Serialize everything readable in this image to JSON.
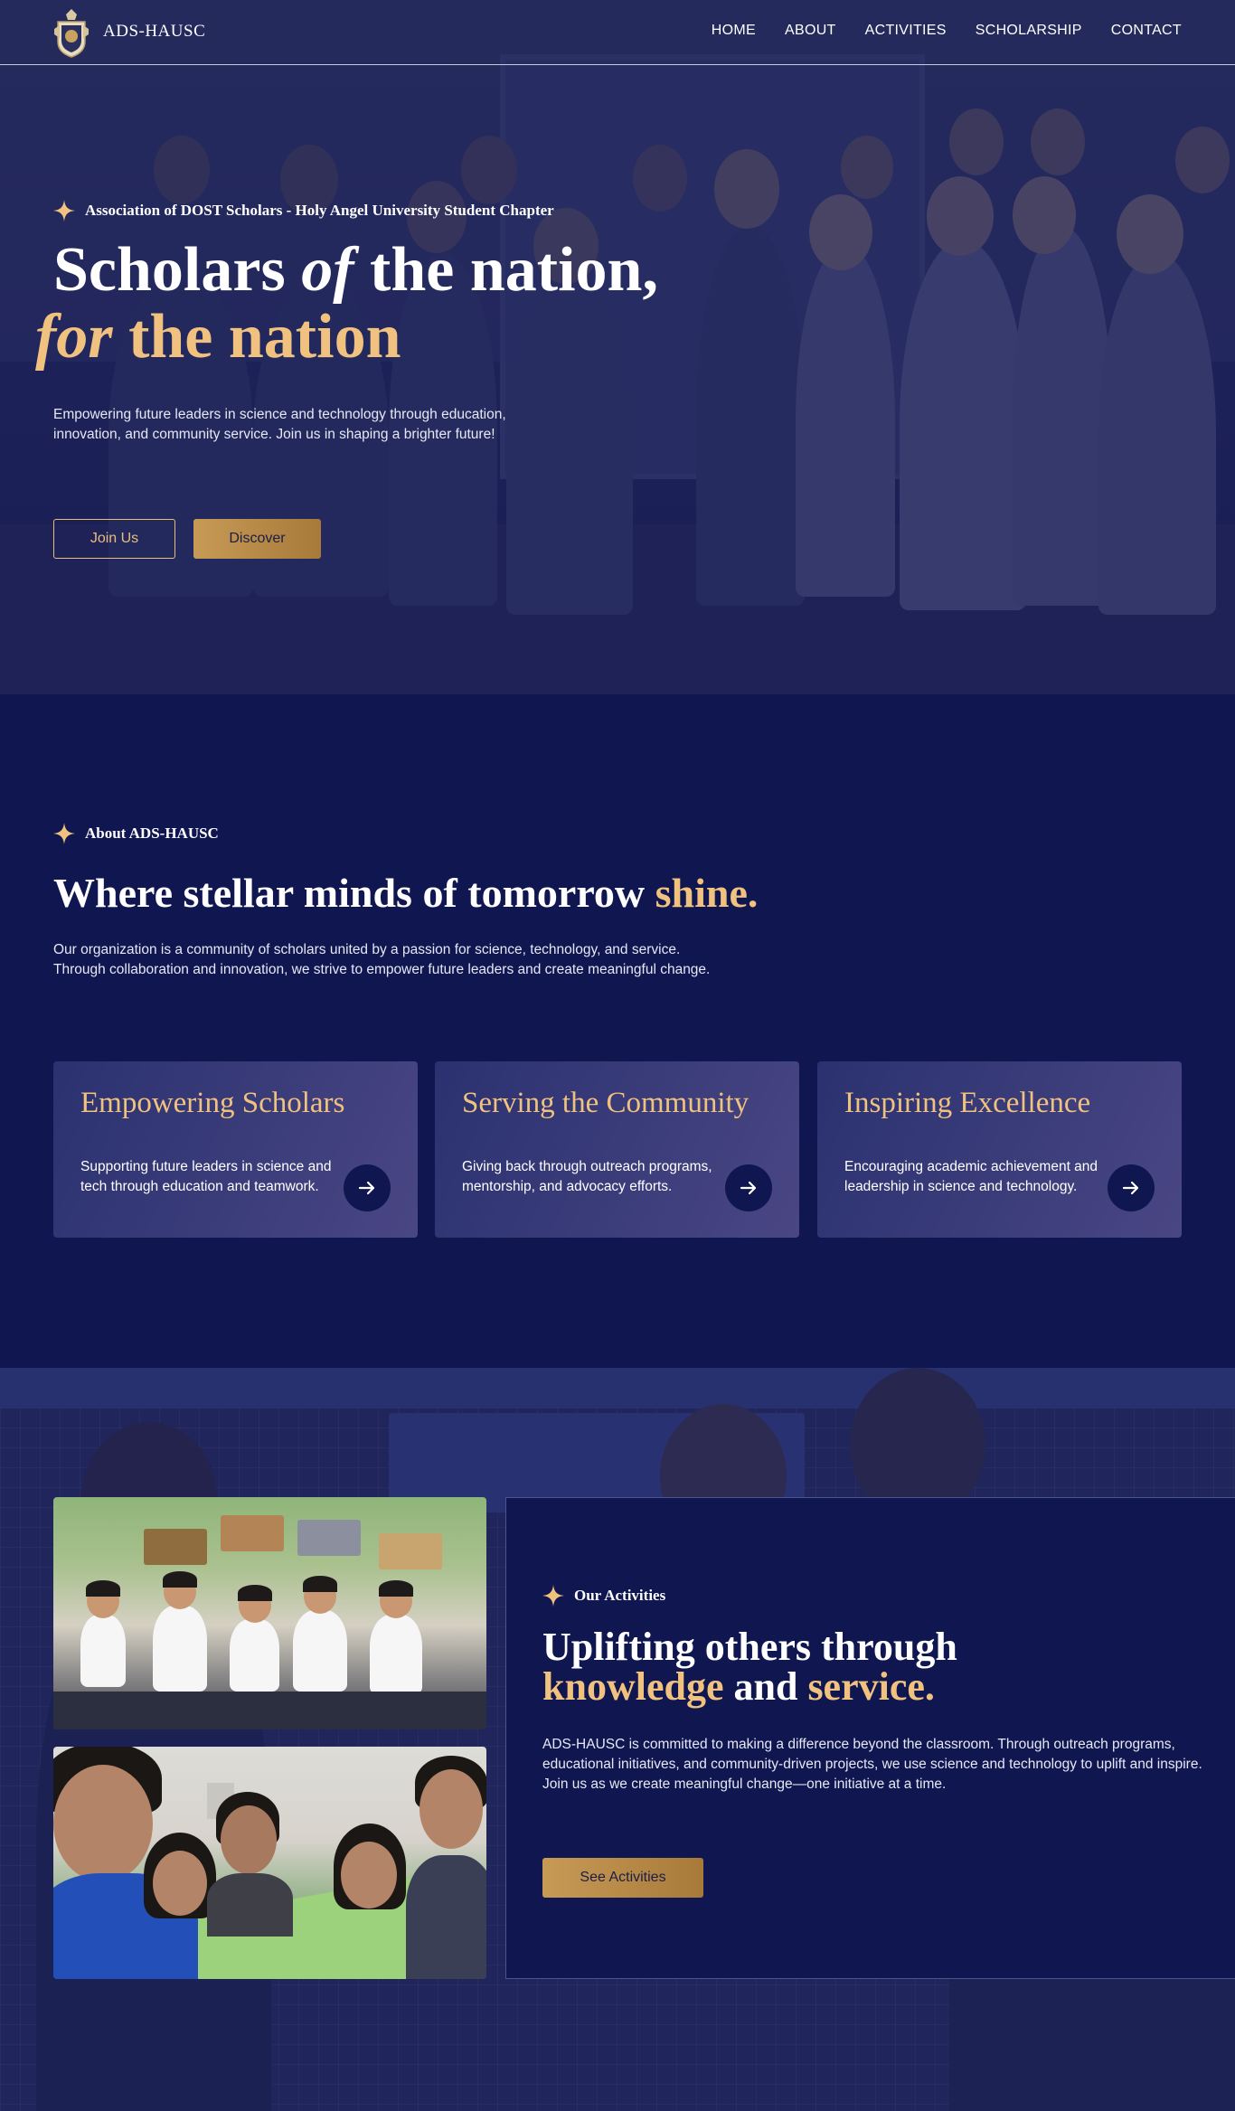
{
  "header": {
    "brand": "ADS-HAUSC",
    "nav": [
      "HOME",
      "ABOUT",
      "ACTIVITIES",
      "SCHOLARSHIP",
      "CONTACT"
    ]
  },
  "hero": {
    "kicker": "Association of DOST Scholars - Holy Angel University Student Chapter",
    "title_part1": "Scholars ",
    "title_of": "of",
    "title_part2": " the nation,",
    "title_for": "for",
    "title_part3": " the nation",
    "description": "Empowering future leaders in science and technology through education, innovation, and community service. Join us in shaping a brighter future!",
    "join_button": "Join Us",
    "discover_button": "Discover"
  },
  "about": {
    "kicker": "About ADS-HAUSC",
    "title_main": "Where stellar minds of tomorrow ",
    "title_accent": "shine.",
    "description": "Our organization is a community of scholars united by a passion for science, technology, and service. Through collaboration and innovation, we strive to empower future leaders and create meaningful change.",
    "cards": [
      {
        "title": "Empowering Scholars",
        "text": "Supporting future leaders in science and tech through education and teamwork."
      },
      {
        "title": "Serving the Community",
        "text": "Giving back through outreach programs, mentorship, and advocacy efforts."
      },
      {
        "title": "Inspiring Excellence",
        "text": "Encouraging academic achievement and leadership in science and technology."
      }
    ]
  },
  "activities": {
    "kicker": "Our Activities",
    "title_line1": "Uplifting others through",
    "title_knowledge": "knowledge",
    "title_and": " and ",
    "title_service": "service.",
    "description": "ADS-HAUSC is committed to making a difference beyond the classroom. Through outreach programs, educational initiatives, and community-driven projects, we use science and technology to uplift and inspire. Join us as we create meaningful change—one initiative at a time.",
    "button": "See Activities"
  },
  "colors": {
    "navy": "#0f1650",
    "gold": "#f1c27f",
    "gold_button": "#c79a56"
  },
  "icons": [
    "logo-emblem",
    "sparkle-star-icon",
    "arrow-right-icon"
  ]
}
